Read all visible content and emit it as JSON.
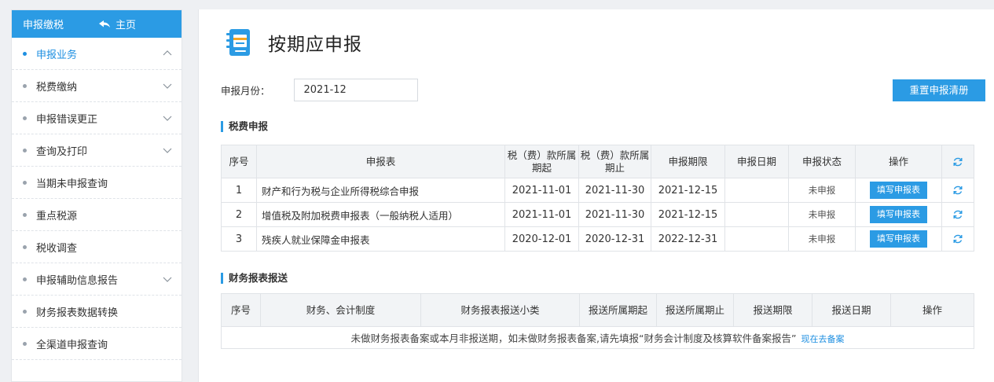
{
  "sidebar": {
    "header": {
      "title": "申报缴税",
      "home_label": "主页"
    },
    "items": [
      {
        "label": "申报业务",
        "active": true,
        "chevron": "up"
      },
      {
        "label": "税费缴纳",
        "chevron": "down"
      },
      {
        "label": "申报错误更正",
        "chevron": "down"
      },
      {
        "label": "查询及打印",
        "chevron": "down"
      },
      {
        "label": "当期未申报查询"
      },
      {
        "label": "重点税源"
      },
      {
        "label": "税收调查"
      },
      {
        "label": "申报辅助信息报告",
        "chevron": "down"
      },
      {
        "label": "财务报表数据转换"
      },
      {
        "label": "全渠道申报查询"
      }
    ]
  },
  "page": {
    "title": "按期应申报",
    "month_label": "申报月份：",
    "month_value": "2021-12",
    "reset_button": "重置申报清册"
  },
  "tax_section": {
    "title": "税费申报",
    "headers": [
      "序号",
      "申报表",
      "税（费）款所属期起",
      "税（费）款所属期止",
      "申报期限",
      "申报日期",
      "申报状态",
      "操作"
    ],
    "rows": [
      {
        "no": "1",
        "form": "财产和行为税与企业所得税综合申报",
        "start": "2021-11-01",
        "end": "2021-11-30",
        "deadline": "2021-12-15",
        "date": "",
        "status": "未申报",
        "action": "填写申报表"
      },
      {
        "no": "2",
        "form": "增值税及附加税费申报表（一般纳税人适用）",
        "start": "2021-11-01",
        "end": "2021-11-30",
        "deadline": "2021-12-15",
        "date": "",
        "status": "未申报",
        "action": "填写申报表"
      },
      {
        "no": "3",
        "form": "残疾人就业保障金申报表",
        "start": "2020-12-01",
        "end": "2020-12-31",
        "deadline": "2022-12-31",
        "date": "",
        "status": "未申报",
        "action": "填写申报表"
      }
    ]
  },
  "finance_section": {
    "title": "财务报表报送",
    "headers": [
      "序号",
      "财务、会计制度",
      "财务报表报送小类",
      "报送所属期起",
      "报送所属期止",
      "报送期限",
      "报送日期",
      "操作"
    ],
    "note": "未做财务报表备案或本月非报送期，如未做财务报表备案,请先填报“财务会计制度及核算软件备案报告”",
    "note_link": "现在去备案"
  },
  "colors": {
    "accent": "#2b9be4",
    "link": "#1e8fe1"
  },
  "icons": {
    "home": "home-icon",
    "refresh": "refresh-icon",
    "chevron": "chevron-icon",
    "logo": "notebook-icon"
  }
}
